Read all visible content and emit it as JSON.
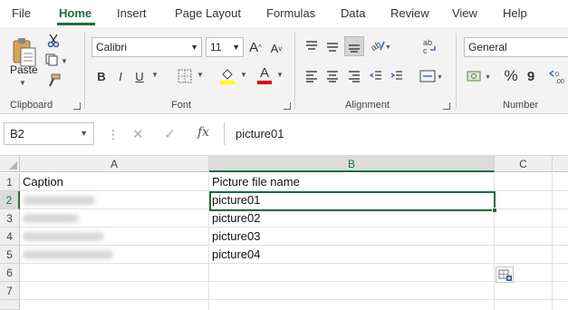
{
  "menu": {
    "tabs": [
      "File",
      "Home",
      "Insert",
      "Page Layout",
      "Formulas",
      "Data",
      "Review",
      "View",
      "Help"
    ],
    "active_tab": "Home"
  },
  "ribbon": {
    "clipboard": {
      "label": "Clipboard",
      "paste_label": "Paste"
    },
    "font": {
      "label": "Font",
      "font_name": "Calibri",
      "font_size": "11",
      "bold": "B",
      "italic": "I",
      "underline": "U",
      "font_color_glyph": "A",
      "highlight_color": "#ffff00",
      "font_color": "#e00000"
    },
    "alignment": {
      "label": "Alignment"
    },
    "number": {
      "label": "Number",
      "format": "General",
      "percent": "%",
      "comma": "9"
    }
  },
  "formula_bar": {
    "name_box": "B2",
    "fx": "fx",
    "value": "picture01"
  },
  "sheet": {
    "columns": [
      "A",
      "B",
      "C"
    ],
    "rows": [
      "1",
      "2",
      "3",
      "4",
      "5",
      "6",
      "7"
    ],
    "headers": {
      "a": "Caption",
      "b": "Picture file name"
    },
    "pictures": [
      "picture01",
      "picture02",
      "picture03",
      "picture04"
    ],
    "selected_cell": "B2",
    "accent": "#1e6c41"
  }
}
